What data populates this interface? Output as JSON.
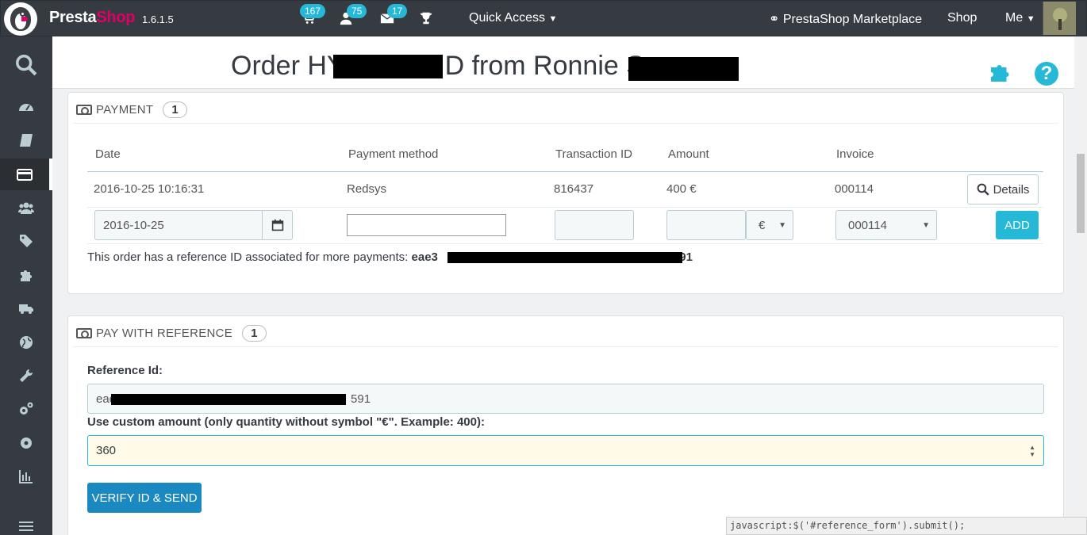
{
  "topbar": {
    "brand_part1": "Presta",
    "brand_part2": "Shop",
    "version": "1.6.1.5",
    "notifications": [
      {
        "icon": "cart-icon",
        "count": "167"
      },
      {
        "icon": "user-icon",
        "count": "75"
      },
      {
        "icon": "envelope-icon",
        "count": "17"
      },
      {
        "icon": "trophy-icon",
        "count": ""
      }
    ],
    "quick_access": "Quick Access",
    "marketplace": "PrestaShop Marketplace",
    "shop": "Shop",
    "me": "Me"
  },
  "sidebar": {
    "items": [
      {
        "icon": "search-icon"
      },
      {
        "icon": "dashboard-icon"
      },
      {
        "icon": "catalog-book-icon"
      },
      {
        "icon": "credit-card-icon",
        "active": true
      },
      {
        "icon": "customers-icon"
      },
      {
        "icon": "price-tags-icon"
      },
      {
        "icon": "modules-puzzle-icon"
      },
      {
        "icon": "truck-icon"
      },
      {
        "icon": "globe-icon"
      },
      {
        "icon": "wrench-icon"
      },
      {
        "icon": "cogs-icon"
      },
      {
        "icon": "gear-icon"
      },
      {
        "icon": "stats-icon"
      },
      {
        "icon": "menu-collapse-icon"
      }
    ]
  },
  "header": {
    "title_part1": "Order HY",
    "title_part2": "D from Ronnie S",
    "help": "?"
  },
  "payment_panel": {
    "title": "PAYMENT",
    "count": "1",
    "columns": [
      "Date",
      "Payment method",
      "Transaction ID",
      "Amount",
      "Invoice"
    ],
    "row": {
      "date": "2016-10-25 10:16:31",
      "method": "Redsys",
      "transaction_id": "816437",
      "amount": "400 €",
      "invoice": "000114",
      "details_label": "Details"
    },
    "form": {
      "date_value": "2016-10-25",
      "method_value": "",
      "transaction_value": "",
      "amount_value": "",
      "currency": "€",
      "invoice": "000114",
      "add_label": "ADD"
    },
    "note_prefix": "This order has a reference ID associated for more payments: ",
    "note_ref_start": "eae3",
    "note_ref_end": "591"
  },
  "reference_panel": {
    "title": "PAY WITH REFERENCE",
    "count": "1",
    "ref_label": "Reference Id:",
    "ref_start": "eae",
    "ref_end": "591",
    "amount_label": "Use custom amount (only quantity without symbol \"€\". Example: 400):",
    "amount_value": "360",
    "verify_label": "VERIFY ID & SEND"
  },
  "statusbar": {
    "text": "javascript:$('#reference_form').submit();"
  },
  "colors": {
    "topbar": "#363a41",
    "accent": "#25b9d7",
    "brand_pink": "#df0067",
    "verify_button": "#1a89c2"
  }
}
